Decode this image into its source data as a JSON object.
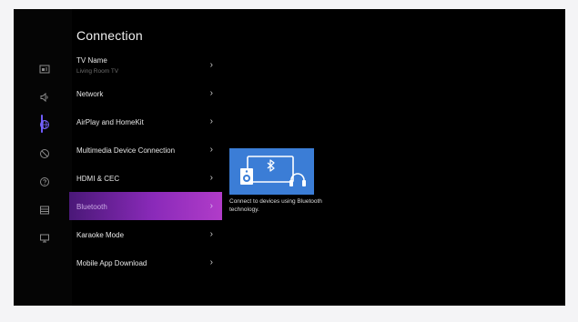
{
  "page": {
    "title": "Connection"
  },
  "sidebar": {
    "icons": [
      "picture-icon",
      "sound-icon",
      "connection-globe-icon",
      "accessibility-icon",
      "support-icon",
      "general-icon",
      "display-icon"
    ],
    "active_index": 2,
    "accent_color": "#6f5cff"
  },
  "menu": {
    "items": [
      {
        "label": "TV Name",
        "sub": "Living Room TV"
      },
      {
        "label": "Network"
      },
      {
        "label": "AirPlay and HomeKit"
      },
      {
        "label": "Multimedia Device Connection"
      },
      {
        "label": "HDMI & CEC"
      },
      {
        "label": "Bluetooth",
        "selected": true
      },
      {
        "label": "Karaoke Mode"
      },
      {
        "label": "Mobile App Download"
      }
    ],
    "chevron": "›"
  },
  "preview": {
    "description": "Connect to devices using Bluetooth technology.",
    "card_color": "#3b7dd6",
    "bluetooth_symbol": "✱"
  }
}
